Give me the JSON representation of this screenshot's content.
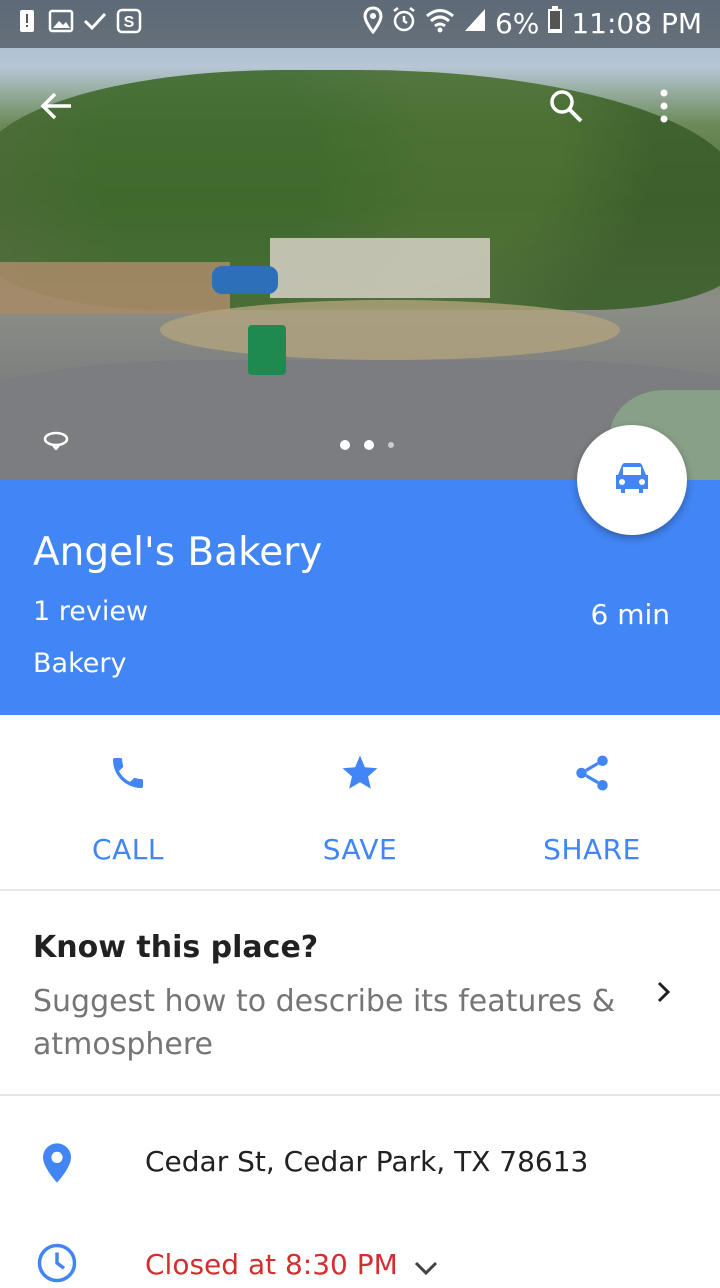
{
  "status_bar": {
    "battery": "6%",
    "time": "11:08 PM"
  },
  "place": {
    "name": "Angel's Bakery",
    "reviews": "1 review",
    "category": "Bakery",
    "eta": "6 min"
  },
  "actions": {
    "call": "CALL",
    "save": "SAVE",
    "share": "SHARE"
  },
  "know": {
    "title": "Know this place?",
    "description": "Suggest how to describe its features & atmosphere"
  },
  "details": {
    "address": "Cedar St, Cedar Park, TX 78613",
    "hours": "Closed at 8:30 PM"
  },
  "colors": {
    "accent": "#4285f4",
    "closed": "#d32f2f"
  }
}
